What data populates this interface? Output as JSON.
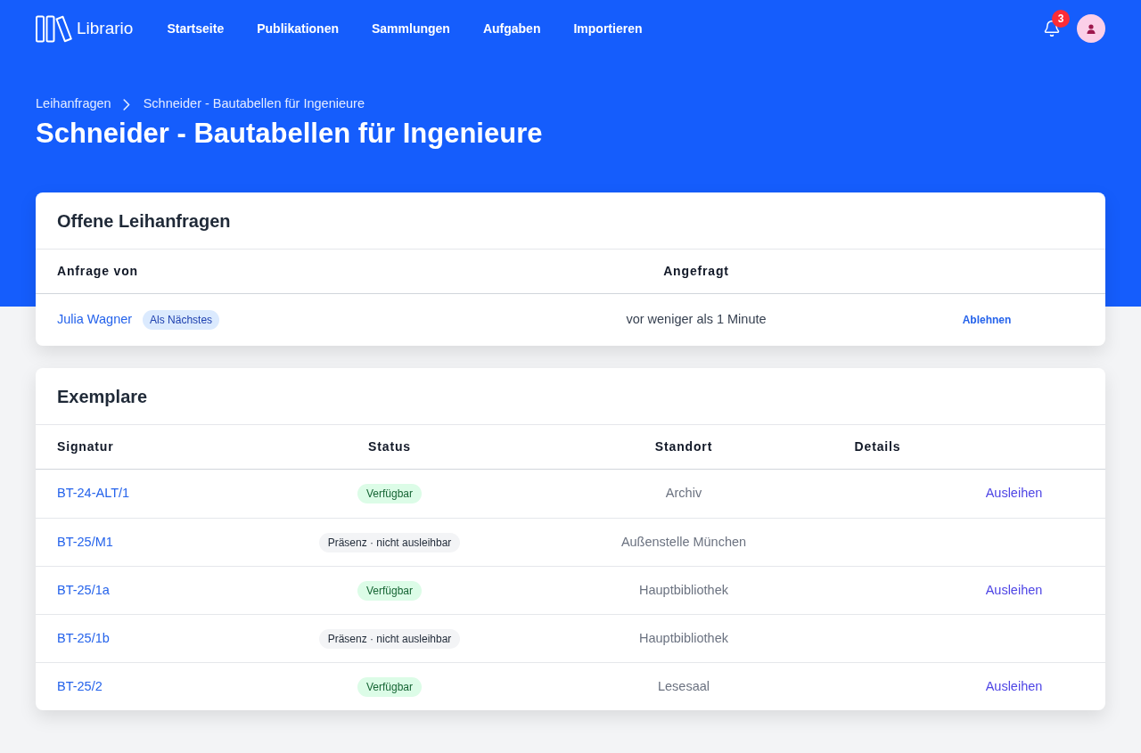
{
  "brand": {
    "name": "Librario"
  },
  "nav": {
    "items": [
      {
        "label": "Startseite"
      },
      {
        "label": "Publikationen"
      },
      {
        "label": "Sammlungen"
      },
      {
        "label": "Aufgaben"
      },
      {
        "label": "Importieren"
      }
    ]
  },
  "notifications": {
    "count": "3"
  },
  "breadcrumb": [
    {
      "label": "Leihanfragen"
    },
    {
      "label": "Schneider - Bautabellen für Ingenieure"
    }
  ],
  "page_title": "Schneider - Bautabellen für Ingenieure",
  "requests": {
    "title": "Offene Leihanfragen",
    "columns": [
      "Anfrage von",
      "Angefragt"
    ],
    "rows": [
      {
        "name": "Julia Wagner",
        "badge": "Als Nächstes",
        "requested": "vor weniger als 1 Minute",
        "action": "Ablehnen"
      }
    ]
  },
  "copies": {
    "title": "Exemplare",
    "columns": [
      "Signatur",
      "Status",
      "Standort",
      "Details"
    ],
    "rows": [
      {
        "signature": "BT-24-ALT/1",
        "status": {
          "label": "Verfügbar",
          "kind": "available"
        },
        "location": "Archiv",
        "action": "Ausleihen"
      },
      {
        "signature": "BT-25/M1",
        "status": {
          "label": "Präsenz · nicht ausleihbar",
          "kind": "reference"
        },
        "location": "Außenstelle München"
      },
      {
        "signature": "BT-25/1a",
        "status": {
          "label": "Verfügbar",
          "kind": "available"
        },
        "location": "Hauptbibliothek",
        "action": "Ausleihen"
      },
      {
        "signature": "BT-25/1b",
        "status": {
          "label": "Präsenz · nicht ausleihbar",
          "kind": "reference"
        },
        "location": "Hauptbibliothek"
      },
      {
        "signature": "BT-25/2",
        "status": {
          "label": "Verfügbar",
          "kind": "available"
        },
        "location": "Lesesaal",
        "action": "Ausleihen"
      }
    ]
  }
}
